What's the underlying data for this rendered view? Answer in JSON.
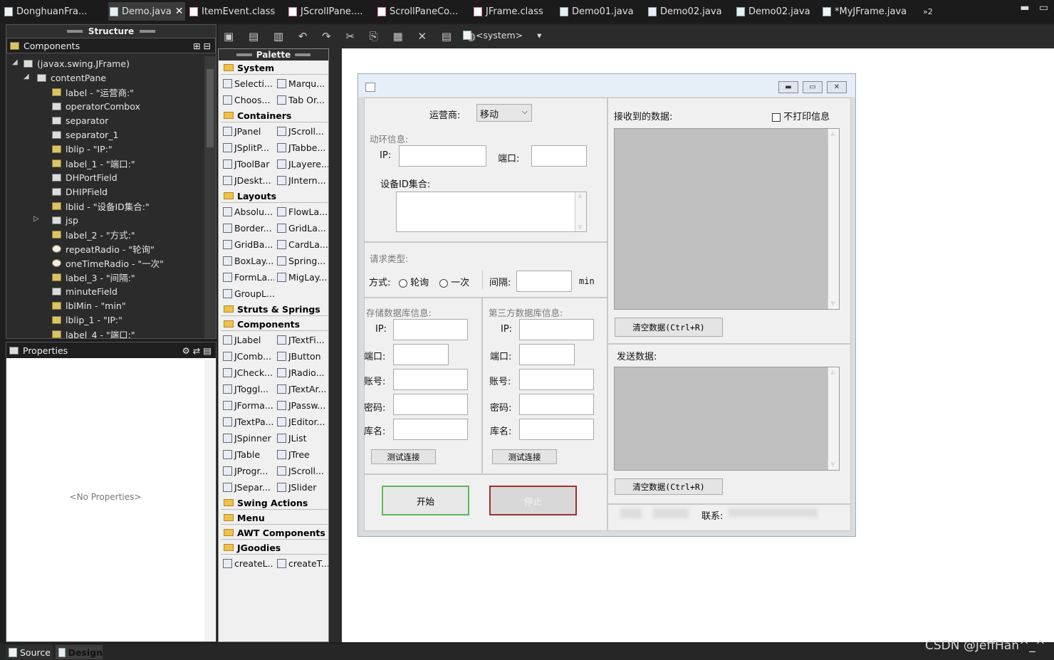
{
  "tabs": [
    {
      "label": "DonghuanFra..."
    },
    {
      "label": "Demo.java"
    },
    {
      "label": "ItemEvent.class"
    },
    {
      "label": "JScrollPane...."
    },
    {
      "label": "ScrollPaneCo..."
    },
    {
      "label": "JFrame.class"
    },
    {
      "label": "Demo01.java"
    },
    {
      "label": "Demo02.java"
    },
    {
      "label": "Demo02.java"
    },
    {
      "label": "*MyJFrame.java"
    }
  ],
  "tab_overflow": "»2",
  "structure": {
    "title": "Structure",
    "components_label": "Components",
    "tree": [
      "(javax.swing.JFrame)",
      "contentPane",
      "label - \"运营商:\"",
      "operatorCombox",
      "separator",
      "separator_1",
      "lblip - \"IP:\"",
      "label_1 - \"端口:\"",
      "DHPortField",
      "DHIPField",
      "lblid - \"设备ID集合:\"",
      "jsp",
      "label_2 - \"方式:\"",
      "repeatRadio - \"轮询\"",
      "oneTimeRadio - \"一次\"",
      "label_3 - \"间隔:\"",
      "minuteField",
      "lblMin - \"min\"",
      "lblip_1 - \"IP:\"",
      "label_4 - \"端口:\""
    ]
  },
  "properties": {
    "title": "Properties",
    "empty": "<No Properties>"
  },
  "palette": {
    "title": "Palette",
    "system_label": "System",
    "system_items": [
      "Selecti...",
      "Marqu...",
      "Choos...",
      "Tab Or..."
    ],
    "containers_label": "Containers",
    "container_items": [
      "JPanel",
      "JScroll...",
      "JSplitP...",
      "JTabbe...",
      "JToolBar",
      "JLayere...",
      "JDeskt...",
      "JIntern..."
    ],
    "layouts_label": "Layouts",
    "layout_items": [
      "Absolu...",
      "FlowLa...",
      "Border...",
      "GridLa...",
      "GridBa...",
      "CardLa...",
      "BoxLay...",
      "Spring...",
      "FormLa...",
      "MigLay...",
      "GroupL..."
    ],
    "struts_label": "Struts & Springs",
    "components_label": "Components",
    "component_items": [
      "JLabel",
      "JTextFi...",
      "JComb...",
      "JButton",
      "JCheck...",
      "JRadio...",
      "JToggl...",
      "JTextAr...",
      "JForma...",
      "JPassw...",
      "JTextPa...",
      "JEditor...",
      "JSpinner",
      "JList",
      "JTable",
      "JTree",
      "JProgr...",
      "JScroll...",
      "JSepar...",
      "JSlider"
    ],
    "swing_actions_label": "Swing Actions",
    "menu_label": "Menu",
    "awt_label": "AWT Components",
    "jgoodies_label": "JGoodies",
    "extra_items": [
      "createL...",
      "createT..."
    ]
  },
  "toolbar": {
    "system_combo": "<system>"
  },
  "form": {
    "operator_label": "运营商:",
    "operator_value": "移动",
    "env_section": "动环信息:",
    "ip_label": "IP:",
    "port_label": "端口:",
    "device_ids_label": "设备ID集合:",
    "request_type_label": "请求类型:",
    "mode_label": "方式:",
    "repeat_label": "轮询",
    "once_label": "一次",
    "interval_label": "间隔:",
    "min_label": "min",
    "storage_db_label": "存储数据库信息:",
    "third_db_label": "第三方数据库信息:",
    "db_ip_label": "IP:",
    "db_port_label": "端口:",
    "db_account_label": "账号:",
    "db_password_label": "密码:",
    "db_name_label": "库名:",
    "test_conn_label": "测试连接",
    "start_label": "开始",
    "stop_label": "停止",
    "received_label": "接收到的数据:",
    "no_print_label": "不打印信息",
    "clear_label": "清空数据(Ctrl+R)",
    "send_label": "发送数据:",
    "contact_label": "联系:"
  },
  "bottom": {
    "source_tab": "Source",
    "design_tab": "Design",
    "watermark": "CSDN @JeffHan^_^"
  }
}
